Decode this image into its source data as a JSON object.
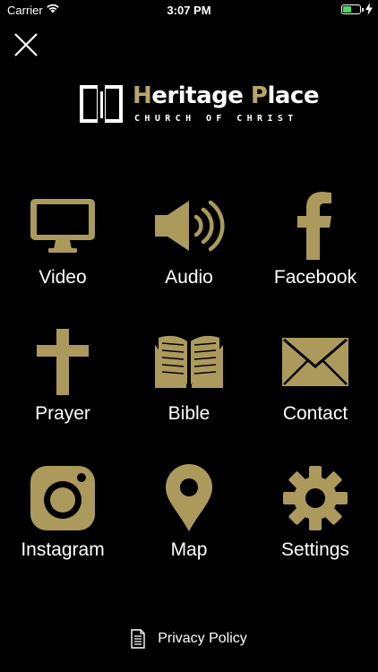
{
  "status_bar": {
    "carrier": "Carrier",
    "time": "3:07 PM"
  },
  "colors": {
    "accent": "#ab9a5c",
    "background": "#000000",
    "text": "#ffffff"
  },
  "logo": {
    "title": "Heritage Place",
    "subtitle": "CHURCH OF CHRIST"
  },
  "menu": [
    {
      "label": "Video",
      "icon": "monitor-icon"
    },
    {
      "label": "Audio",
      "icon": "speaker-icon"
    },
    {
      "label": "Facebook",
      "icon": "facebook-icon"
    },
    {
      "label": "Prayer",
      "icon": "cross-icon"
    },
    {
      "label": "Bible",
      "icon": "open-book-icon"
    },
    {
      "label": "Contact",
      "icon": "envelope-icon"
    },
    {
      "label": "Instagram",
      "icon": "instagram-icon"
    },
    {
      "label": "Map",
      "icon": "map-pin-icon"
    },
    {
      "label": "Settings",
      "icon": "gear-icon"
    }
  ],
  "footer": {
    "privacy_label": "Privacy Policy",
    "icon": "document-icon"
  }
}
